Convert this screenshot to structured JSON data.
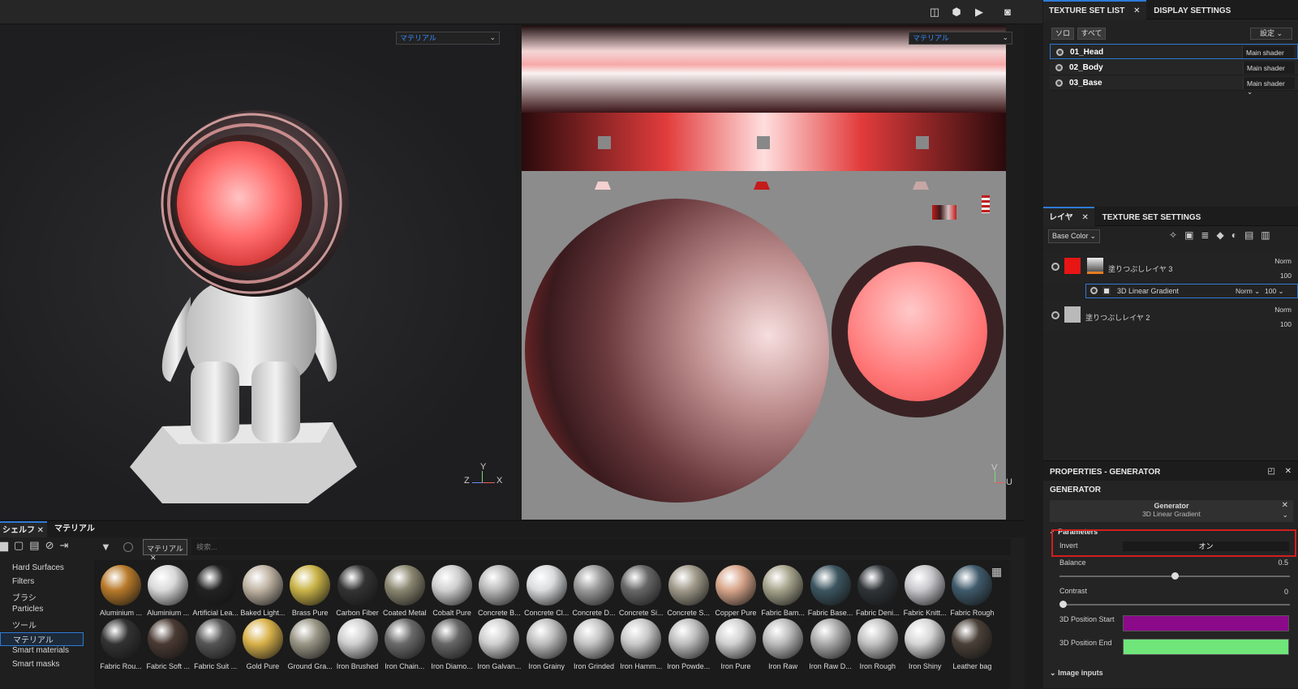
{
  "toolbar": {
    "icons": [
      "split-view-icon",
      "cube-icon",
      "video-camera-icon",
      "camera-icon"
    ]
  },
  "viewport3d": {
    "dropdown": "マテリアル",
    "axes": {
      "x": "X",
      "y": "Y",
      "z": "Z"
    }
  },
  "viewport2d": {
    "dropdown": "マテリアル",
    "axes": {
      "u": "U",
      "v": "V"
    }
  },
  "texture_set_list": {
    "tab_active": "TEXTURE SET LIST",
    "tab_other": "DISPLAY SETTINGS",
    "btn_solo": "ソロ",
    "btn_all": "すべて",
    "btn_settings": "設定",
    "rows": [
      {
        "name": "01_Head",
        "shader": "Main shader"
      },
      {
        "name": "02_Body",
        "shader": "Main shader"
      },
      {
        "name": "03_Base",
        "shader": "Main shader"
      }
    ]
  },
  "layers": {
    "tab_active": "レイヤ",
    "tab_other": "TEXTURE SET SETTINGS",
    "channel": "Base Color",
    "items": [
      {
        "name": "塗りつぶしレイヤ 3",
        "blend": "Norm",
        "opacity": "100",
        "color": "#e81515"
      },
      {
        "name": "3D Linear Gradient",
        "blend": "Norm",
        "opacity": "100"
      },
      {
        "name": "塗りつぶしレイヤ 2",
        "blend": "Norm",
        "opacity": "100",
        "color": "#b9b9b9"
      }
    ]
  },
  "properties": {
    "header": "PROPERTIES - GENERATOR",
    "section": "GENERATOR",
    "generator_label": "Generator",
    "generator_value": "3D Linear Gradient",
    "parameters_label": "Parameters",
    "marker": "8",
    "invert_label": "Invert",
    "invert_value": "オン",
    "balance_label": "Balance",
    "balance_value": "0.5",
    "balance_fraction": 0.5,
    "contrast_label": "Contrast",
    "contrast_value": "0",
    "contrast_fraction": 0,
    "pos_start_label": "3D Position Start",
    "pos_start_color": "#8a0a8a",
    "pos_end_label": "3D Position End",
    "pos_end_color": "#6fe57a",
    "image_inputs_label": "Image inputs"
  },
  "shelf": {
    "tab_shelf": "シェルフ",
    "tab_material": "マテリアル",
    "filter_chip": "マテリアル",
    "search_placeholder": "検索...",
    "categories": [
      "Hard Surfaces",
      "Filters",
      "ブラシ",
      "Particles",
      "ツール",
      "マテリアル",
      "Smart materials",
      "Smart masks"
    ],
    "selected_category": "マテリアル",
    "materials_row1": [
      "Aluminium ...",
      "Aluminium ...",
      "Artificial Lea...",
      "Baked Light...",
      "Brass Pure",
      "Carbon Fiber",
      "Coated Metal",
      "Cobalt Pure",
      "Concrete B...",
      "Concrete Cl...",
      "Concrete D...",
      "Concrete Si...",
      "Concrete S...",
      "Copper Pure",
      "Fabric Bam...",
      "Fabric Base...",
      "Fabric Deni...",
      "Fabric Knitt...",
      "Fabric Rough"
    ],
    "materials_row2": [
      "Fabric Rou...",
      "Fabric Soft ...",
      "Fabric Suit ...",
      "Gold Pure",
      "Ground Gra...",
      "Iron Brushed",
      "Iron Chain...",
      "Iron Diamo...",
      "Iron Galvan...",
      "Iron Grainy",
      "Iron Grinded",
      "Iron Hamm...",
      "Iron Powde...",
      "Iron Pure",
      "Iron Raw",
      "Iron Raw D...",
      "Iron Rough",
      "Iron Shiny",
      "Leather bag"
    ]
  }
}
